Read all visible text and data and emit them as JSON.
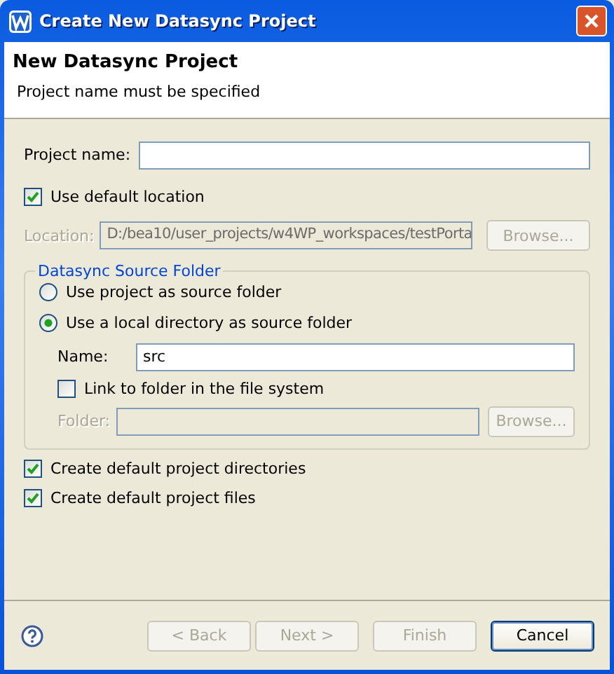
{
  "window": {
    "title": "Create New Datasync Project"
  },
  "header": {
    "title": "New Datasync Project",
    "message": "Project name must be specified"
  },
  "project_name": {
    "label": "Project name:"
  },
  "use_default_location": {
    "label": "Use default location",
    "checked": true
  },
  "location": {
    "label": "Location:",
    "value": "D:/bea10/user_projects/w4WP_workspaces/testPorta",
    "disabled": true,
    "browse": "Browse..."
  },
  "source_folder": {
    "title": "Datasync Source Folder",
    "options": [
      {
        "label": "Use project as source folder",
        "selected": false
      },
      {
        "label": "Use a local directory as source folder",
        "selected": true
      }
    ],
    "name": {
      "label": "Name:",
      "value": "src"
    },
    "link_folder": {
      "label": "Link to folder in the file system",
      "checked": false
    },
    "folder": {
      "label": "Folder:",
      "disabled": true,
      "browse": "Browse..."
    }
  },
  "options": [
    {
      "label": "Create default project directories",
      "checked": true
    },
    {
      "label": "Create default project files",
      "checked": true
    }
  ],
  "buttons": [
    {
      "label": "< Back",
      "disabled": true,
      "focused": false
    },
    {
      "label": "Next >",
      "disabled": true,
      "focused": false
    },
    {
      "label": "Finish",
      "disabled": true,
      "focused": false
    },
    {
      "label": "Cancel",
      "disabled": false,
      "focused": true
    }
  ]
}
